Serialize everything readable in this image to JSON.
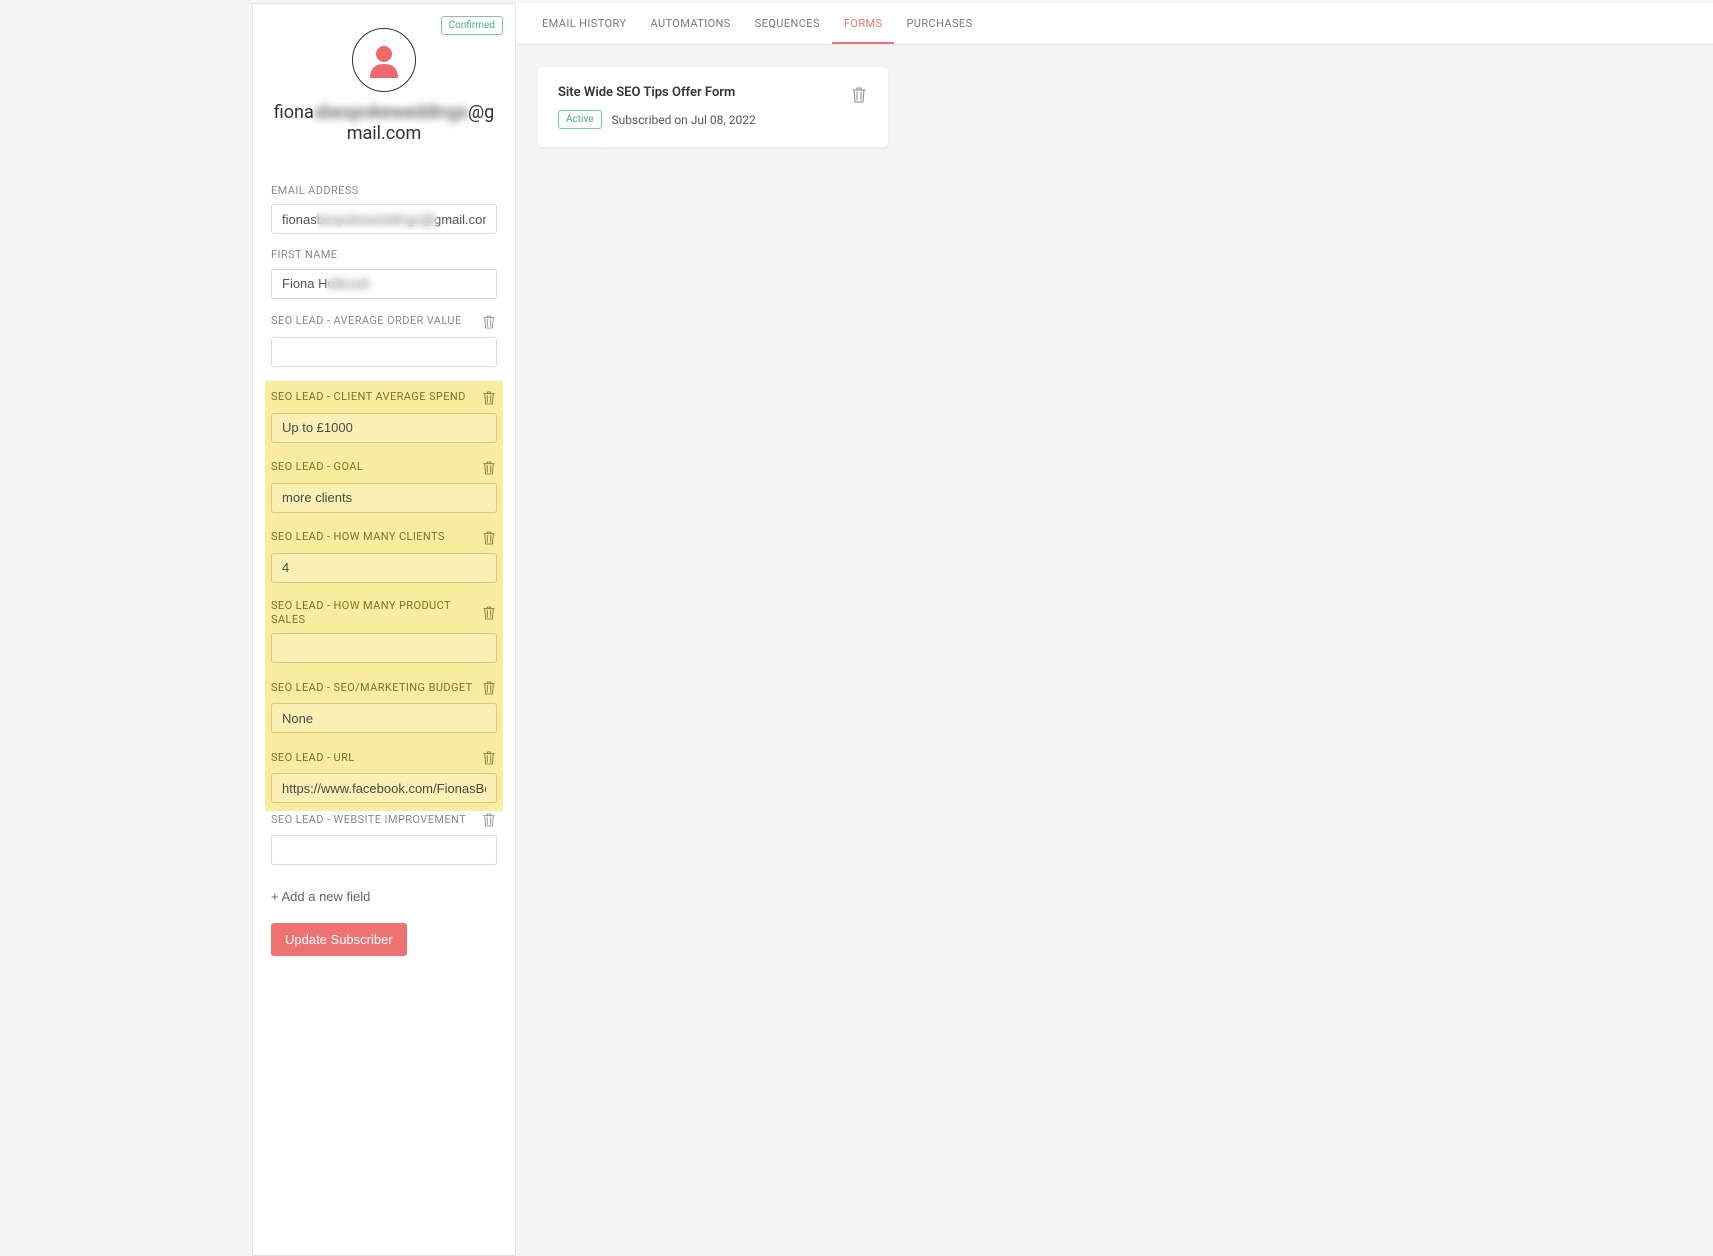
{
  "sidebar": {
    "confirmed_badge": "Confirmed",
    "email_display_prefix": "fiona",
    "email_display_middle": "sbespokeweddings",
    "email_display_suffix": "@gmail.com",
    "fields": {
      "email": {
        "label": "EMAIL ADDRESS",
        "value": "fionasbespokeweddings@gmail.com",
        "has_trash": false,
        "highlight": false,
        "blur": "email"
      },
      "first_name": {
        "label": "FIRST NAME",
        "value": "Fiona Holbrook",
        "has_trash": false,
        "highlight": false,
        "blur": "name"
      },
      "aov": {
        "label": "SEO LEAD - AVERAGE ORDER VALUE",
        "value": "",
        "has_trash": true,
        "highlight": false
      },
      "spend": {
        "label": "SEO LEAD - CLIENT AVERAGE SPEND",
        "value": "Up to £1000",
        "has_trash": true,
        "highlight": true
      },
      "goal": {
        "label": "SEO LEAD - GOAL",
        "value": "more clients",
        "has_trash": true,
        "highlight": true
      },
      "clients": {
        "label": "SEO LEAD - HOW MANY CLIENTS",
        "value": "4",
        "has_trash": true,
        "highlight": true
      },
      "products": {
        "label": "SEO LEAD - HOW MANY PRODUCT SALES",
        "value": "",
        "has_trash": true,
        "highlight": true
      },
      "budget": {
        "label": "SEO LEAD - SEO/MARKETING BUDGET",
        "value": "None",
        "has_trash": true,
        "highlight": true
      },
      "url": {
        "label": "SEO LEAD - URL",
        "value": "https://www.facebook.com/FionasBespoke",
        "has_trash": true,
        "highlight": true
      },
      "improve": {
        "label": "SEO LEAD - WEBSITE IMPROVEMENT",
        "value": "",
        "has_trash": true,
        "highlight": false
      }
    },
    "add_field": "+ Add a new field",
    "update_btn": "Update Subscriber"
  },
  "tabs": {
    "email_history": "EMAIL HISTORY",
    "automations": "AUTOMATIONS",
    "sequences": "SEQUENCES",
    "forms": "FORMS",
    "purchases": "PURCHASES"
  },
  "form_card": {
    "title": "Site Wide SEO Tips Offer Form",
    "status": "Active",
    "subscribed": "Subscribed on Jul 08, 2022"
  }
}
